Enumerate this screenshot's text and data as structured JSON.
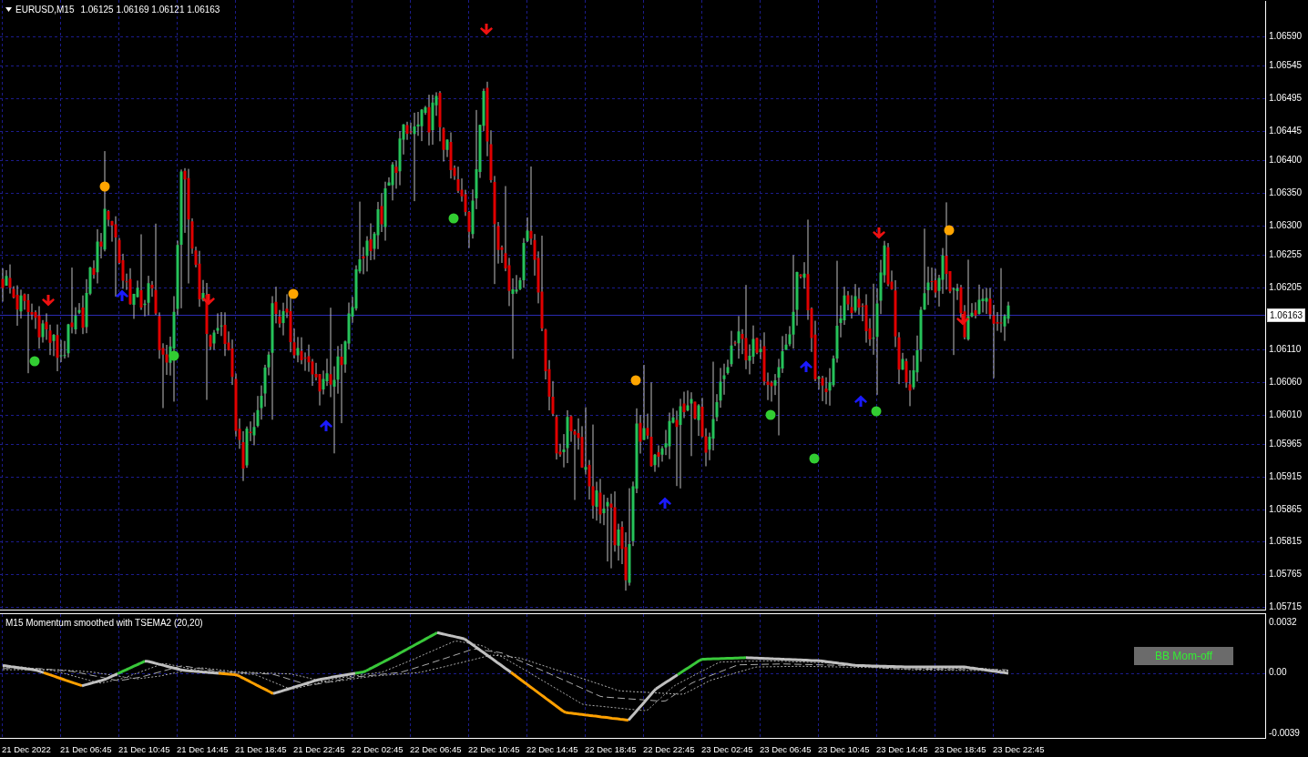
{
  "chart": {
    "symbol": "EURUSD,M15",
    "ohlc": [
      "1.06125",
      "1.06169",
      "1.06121",
      "1.06163"
    ],
    "current_price": "1.06163",
    "price_axis": [
      "1.06590",
      "1.06545",
      "1.06495",
      "1.06445",
      "1.06400",
      "1.06350",
      "1.06300",
      "1.06255",
      "1.06205",
      "1.06110",
      "1.06060",
      "1.06010",
      "1.05965",
      "1.05915",
      "1.05865",
      "1.05815",
      "1.05765",
      "1.05715"
    ]
  },
  "indicator": {
    "title": "M15 Momentum smoothed with TSEMA2 (20,20)",
    "axis": [
      "0.0032",
      "0.00",
      "-0.0039"
    ],
    "button": "BB Mom-off"
  },
  "time_axis": [
    "21 Dec 2022",
    "21 Dec 06:45",
    "21 Dec 10:45",
    "21 Dec 14:45",
    "21 Dec 18:45",
    "21 Dec 22:45",
    "22 Dec 02:45",
    "22 Dec 06:45",
    "22 Dec 10:45",
    "22 Dec 14:45",
    "22 Dec 18:45",
    "22 Dec 22:45",
    "23 Dec 02:45",
    "23 Dec 06:45",
    "23 Dec 10:45",
    "23 Dec 14:45",
    "23 Dec 18:45",
    "23 Dec 22:45"
  ]
}
